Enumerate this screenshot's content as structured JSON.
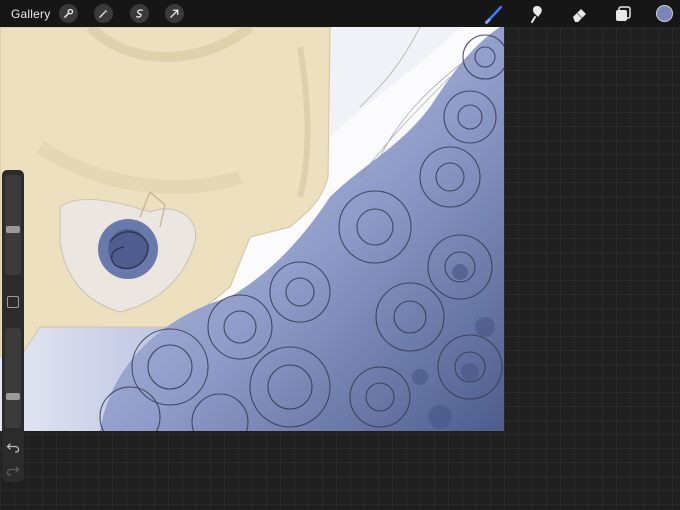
{
  "toolbar": {
    "gallery_label": "Gallery",
    "action_icons": [
      "wrench-icon",
      "magic-wand-icon",
      "selection-icon",
      "transform-arrow-icon"
    ],
    "tool_icons": [
      "brush-icon",
      "smudge-icon",
      "eraser-icon",
      "layers-icon"
    ],
    "active_tool": "brush-icon",
    "active_tool_color": "#3d7bff",
    "current_color": "#7a86b5"
  },
  "sidebar": {
    "brush_size_level": 0.45,
    "opacity_level": 0.3,
    "icons": [
      "modify-square-icon",
      "undo-icon",
      "redo-icon"
    ]
  },
  "canvas": {
    "palette": {
      "sweater": "#ece0bf",
      "skin": "#e9e2da",
      "rose_blue": "#8f9cc9",
      "rose_dark": "#43537f",
      "line": "#33394f"
    }
  }
}
